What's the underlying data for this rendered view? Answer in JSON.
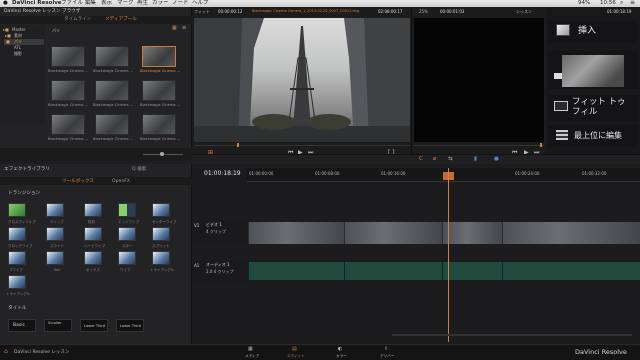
{
  "menubar": {
    "app": "DaVinci Resolve",
    "items": [
      "ファイル",
      "編集",
      "表示",
      "マーク",
      "再生",
      "カラー",
      "ノード",
      "ヘルプ"
    ],
    "right_pct": "94%",
    "right_time": "10:56"
  },
  "window": {
    "title": "DaVinci Resolve レッスン ブラウザ"
  },
  "browser": {
    "tabs": [
      "タイムライン",
      "メディアプール"
    ],
    "active_tab": 1,
    "folders": [
      "Master",
      "素材",
      "パリ",
      "ATL",
      "撮影"
    ],
    "header": "パリ",
    "clips": [
      {
        "label": "Blackmagic Cinema ..."
      },
      {
        "label": "Blackmagic Cinema ..."
      },
      {
        "label": "Blackmagic Cinema ..."
      },
      {
        "label": "Blackmagic Cinema ..."
      },
      {
        "label": "Blackmagic Cinema ..."
      },
      {
        "label": "Blackmagic Cinema ..."
      },
      {
        "label": "Blackmagic Cinema ..."
      },
      {
        "label": "Blackmagic Cinema ..."
      },
      {
        "label": "Blackmagic Cinema ..."
      }
    ]
  },
  "source_viewer": {
    "fit": "フィット",
    "timecode_left": "00:00:00:12",
    "clip_name": "Blackmagic Cinema Camera_1_2013-02-25_0007_C0011.dng",
    "timecode_right": "02:08:00:17"
  },
  "timeline_viewer": {
    "zoom": "25%",
    "timecode_left": "00:00:01:03",
    "label": "レッスン",
    "timecode_right": "01:00:18:19"
  },
  "edit_overlay": [
    {
      "label": "挿入"
    },
    {
      "label": ""
    },
    {
      "label": "フィット トゥ フィル"
    },
    {
      "label": "最上位に編集"
    }
  ],
  "effects": {
    "title": "エフェクトライブラリ",
    "search": "Q 検索",
    "tabs": [
      "ツールボックス",
      "OpenFX"
    ],
    "transitions_header": "トランジション",
    "transitions": [
      "クロスディゾルブ",
      "ディップ",
      "虹彩",
      "エッジワイプ",
      "センターワイプ",
      "クロックワイプ",
      "スライド",
      "ハートワイプ",
      "スター",
      "スプリット",
      "2ワイプ",
      "Ken",
      "ボックス",
      "ワイプ",
      "トライアングル",
      "トライアングル"
    ],
    "titles_header": "タイトル",
    "titles": [
      "Basic",
      "Scroller",
      "Lower Third",
      "Lower Third"
    ]
  },
  "timeline": {
    "timecode": "01:00:18:19",
    "ruler": [
      "01:00:00:00",
      "01:00:08:00",
      "01:00:16:00",
      "01:00:24:00",
      "01:00:32:00"
    ],
    "tracks": [
      {
        "id": "V1",
        "name": "ビデオ 1",
        "info": "4 クリップ"
      },
      {
        "id": "A1",
        "name": "オーディオ 1",
        "info": "2.0 4 クリップ"
      }
    ]
  },
  "bottom": {
    "project": "DaVinci Resolve レッスン",
    "tabs": [
      "メディア",
      "エディット",
      "カラー",
      "デリバー"
    ],
    "active": 1,
    "brand": "DaVinci Resolve"
  }
}
